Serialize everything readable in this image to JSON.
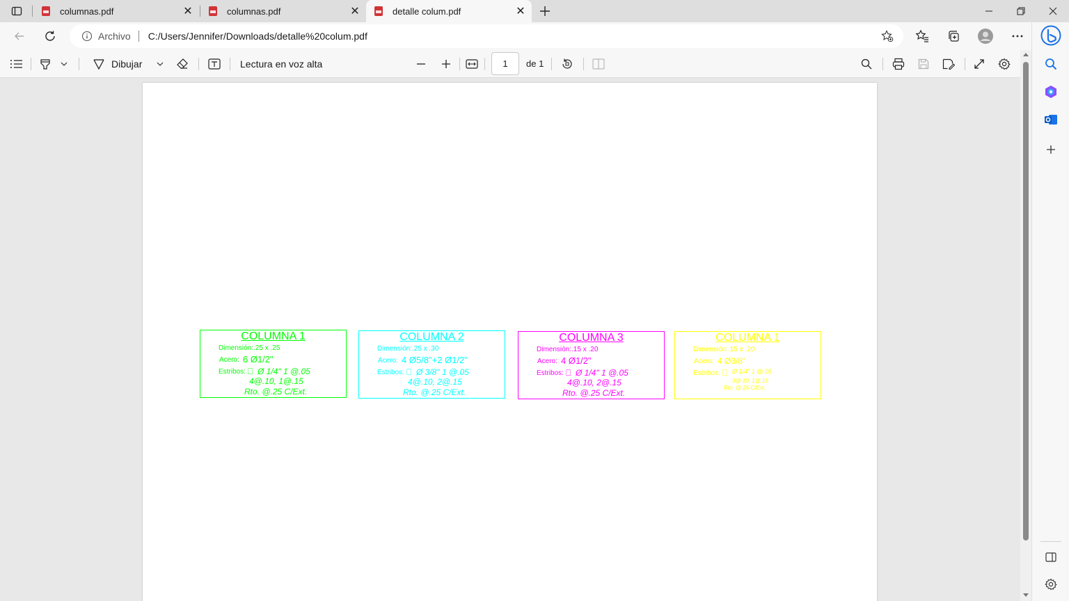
{
  "browser": {
    "tabs": [
      {
        "title": "columnas.pdf",
        "active": false
      },
      {
        "title": "columnas.pdf",
        "active": false
      },
      {
        "title": "detalle colum.pdf",
        "active": true
      }
    ],
    "origin_label": "Archivo",
    "url": "C:/Users/Jennifer/Downloads/detalle%20colum.pdf"
  },
  "pdf_toolbar": {
    "draw_label": "Dibujar",
    "read_aloud_label": "Lectura en voz alta",
    "page_number": "1",
    "page_of": "de 1"
  },
  "document": {
    "columns": [
      {
        "color": "#00ff00",
        "title": "COLUMNA 1",
        "dimension": "Dimensión:.25 x .25",
        "acero_label": "Acero:",
        "acero_value": "6 Ø1/2\"",
        "estribos_label": "Estribos:",
        "estribos_1": "Ø 1/4\" 1 @.05",
        "estribos_2": "4@.10, 1@.15",
        "estribos_3": "Rto. @.25 C/Ext."
      },
      {
        "color": "#00ffff",
        "title": "COLUMNA 2",
        "dimension": "Dimensión:.25 x .30",
        "acero_label": "Acero:",
        "acero_value": "4 Ø5/8\"+2 Ø1/2\"",
        "estribos_label": "Estribos:",
        "estribos_1": "Ø 3/8\" 1 @.05",
        "estribos_2": "4@.10, 2@.15",
        "estribos_3": "Rto. @.25 C/Ext."
      },
      {
        "color": "#ff00ff",
        "title": "COLUMNA 3",
        "dimension": "Dimensión:.15 x .20",
        "acero_label": "Acero:",
        "acero_value": "4 Ø1/2\"",
        "estribos_label": "Estribos:",
        "estribos_1": "Ø 1/4\" 1 @.05",
        "estribos_2": "4@.10, 2@.15",
        "estribos_3": "Rto. @.25 C/Ext."
      },
      {
        "color": "#ffff00",
        "title": "COLUMNA 1",
        "dimension": "Dimensión:.15 x .20",
        "acero_label": "Acero:",
        "acero_value": "4 Ø3/8\"",
        "estribos_label": "Estribos:",
        "estribos_1": "Ø 1/4\" 1 @.05",
        "estribos_2": "3@.10, 1@.15",
        "estribos_3": "Rto. @.25 C/Ext."
      }
    ]
  },
  "icons": {
    "pdf_tab_icon_color": "#d13438",
    "copilot_colors": [
      "#1a73e8",
      "#8a4fff"
    ]
  }
}
